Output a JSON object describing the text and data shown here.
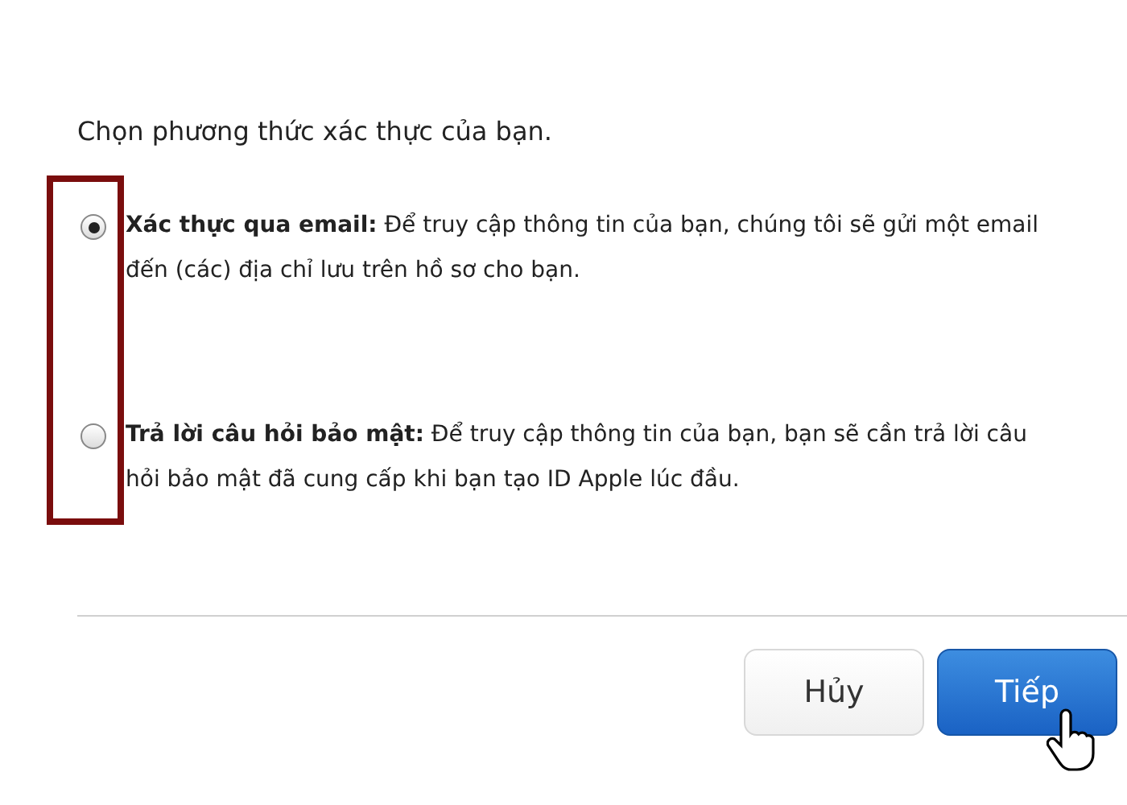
{
  "heading": "Chọn phương thức xác thực của bạn.",
  "options": [
    {
      "text": "**Xác thực qua email:** Để truy cập thông tin của bạn, chúng tôi sẽ gửi một email đến (các) địa chỉ lưu trên hồ sơ cho bạn.",
      "selected": true
    },
    {
      "text": "**Trả lời câu hỏi bảo mật:** Để truy cập thông tin của bạn, bạn sẽ cần trả lời câu hỏi bảo mật đã cung cấp khi bạn tạo ID Apple lúc đầu.",
      "selected": false
    }
  ],
  "buttons": [
    {
      "label": "Hủy",
      "kind": "secondary"
    },
    {
      "label": "Tiếp",
      "kind": "primary"
    }
  ]
}
